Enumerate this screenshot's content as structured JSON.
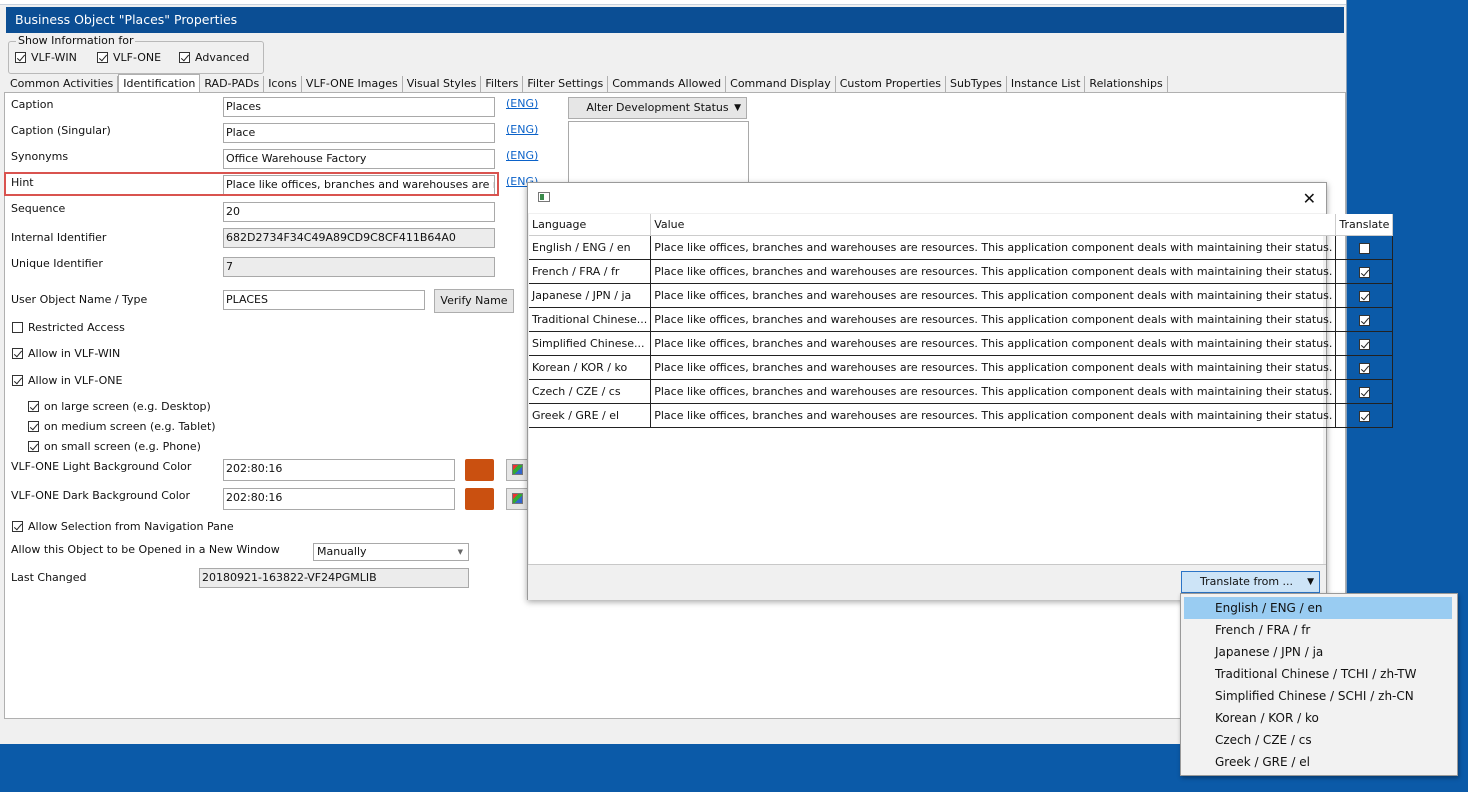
{
  "window": {
    "title": "Business Object \"Places\" Properties"
  },
  "show_info": {
    "legend": "Show Information for",
    "options": [
      {
        "label": "VLF-WIN",
        "checked": true
      },
      {
        "label": "VLF-ONE",
        "checked": true
      },
      {
        "label": "Advanced",
        "checked": true
      }
    ]
  },
  "tabs": [
    "Common Activities",
    "Identification",
    "RAD-PADs",
    "Icons",
    "VLF-ONE Images",
    "Visual Styles",
    "Filters",
    "Filter Settings",
    "Commands Allowed",
    "Command Display",
    "Custom Properties",
    "SubTypes",
    "Instance List",
    "Relationships"
  ],
  "active_tab": "Identification",
  "form": {
    "caption_label": "Caption",
    "caption_value": "Places",
    "caption_singular_label": "Caption (Singular)",
    "caption_singular_value": "Place",
    "synonyms_label": "Synonyms",
    "synonyms_value": "Office Warehouse Factory",
    "hint_label": "Hint",
    "hint_value": "Place like offices, branches and warehouses are resources. This application component deals with maintaining their status.",
    "eng_link": "(ENG)",
    "sequence_label": "Sequence",
    "sequence_value": "20",
    "internal_id_label": "Internal Identifier",
    "internal_id_value": "682D2734F34C49A89CD9C8CF411B64A0",
    "unique_id_label": "Unique Identifier",
    "unique_id_value": "7",
    "user_object_label": "User Object Name / Type",
    "user_object_value": "PLACES",
    "verify_name_button": "Verify Name",
    "restricted_access": "Restricted Access",
    "allow_vlf_win": "Allow in VLF-WIN",
    "allow_vlf_one": "Allow in VLF-ONE",
    "large_screen": "on large screen (e.g. Desktop)",
    "medium_screen": "on medium screen (e.g. Tablet)",
    "small_screen": "on small screen (e.g. Phone)",
    "light_bg_label": "VLF-ONE Light Background Color",
    "light_bg_value": "202:80:16",
    "dark_bg_label": "VLF-ONE Dark Background Color",
    "dark_bg_value": "202:80:16",
    "swatch_color": "#ca5010",
    "allow_selection": "Allow Selection from Navigation Pane",
    "new_window_label": "Allow this Object to be Opened in a New Window",
    "new_window_value": "Manually",
    "last_changed_label": "Last Changed",
    "last_changed_value": "20180921-163822-VF24PGMLIB",
    "alter_status_button": "Alter Development Status"
  },
  "dialog": {
    "columns": [
      "Language",
      "Value",
      "Translate"
    ],
    "rows": [
      {
        "language": "English / ENG / en",
        "value": "Place like offices, branches and warehouses are resources. This application component deals with maintaining their status.",
        "translate": false
      },
      {
        "language": "French / FRA / fr",
        "value": "Place like offices, branches and warehouses are resources. This application component deals with maintaining their status.",
        "translate": true
      },
      {
        "language": "Japanese / JPN / ja",
        "value": "Place like offices, branches and warehouses are resources. This application component deals with maintaining their status.",
        "translate": true
      },
      {
        "language": "Traditional Chinese...",
        "value": "Place like offices, branches and warehouses are resources. This application component deals with maintaining their status.",
        "translate": true
      },
      {
        "language": "Simplified Chinese...",
        "value": "Place like offices, branches and warehouses are resources. This application component deals with maintaining their status.",
        "translate": true
      },
      {
        "language": "Korean / KOR / ko",
        "value": "Place like offices, branches and warehouses are resources. This application component deals with maintaining their status.",
        "translate": true
      },
      {
        "language": "Czech / CZE / cs",
        "value": "Place like offices, branches and warehouses are resources. This application component deals with maintaining their status.",
        "translate": true
      },
      {
        "language": "Greek / GRE / el",
        "value": "Place like offices, branches and warehouses are resources. This application component deals with maintaining their status.",
        "translate": true
      }
    ],
    "translate_from_button": "Translate from ..."
  },
  "language_menu": {
    "items": [
      "English / ENG / en",
      "French / FRA / fr",
      "Japanese / JPN / ja",
      "Traditional Chinese / TCHI / zh-TW",
      "Simplified Chinese / SCHI / zh-CN",
      "Korean / KOR / ko",
      "Czech / CZE / cs",
      "Greek / GRE / el"
    ],
    "highlighted": "English / ENG / en"
  }
}
